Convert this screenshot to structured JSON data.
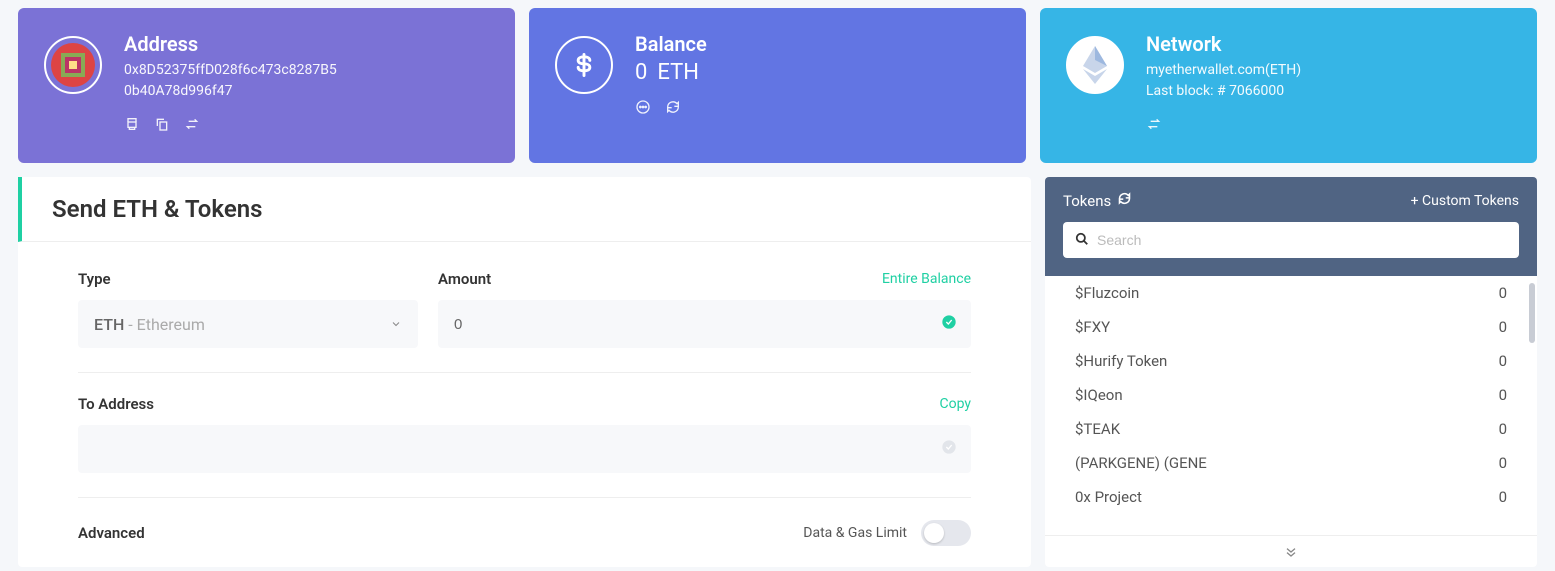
{
  "address_card": {
    "title": "Address",
    "line1": "0x8D52375ffD028f6c473c8287B5",
    "line2": "0b40A78d996f47"
  },
  "balance_card": {
    "title": "Balance",
    "amount": "0",
    "unit": "ETH"
  },
  "network_card": {
    "title": "Network",
    "name": "myetherwallet.com(ETH)",
    "last_block": "Last block: # 7066000"
  },
  "send": {
    "title": "Send ETH & Tokens",
    "type_label": "Type",
    "type_symbol": "ETH",
    "type_name": " - Ethereum",
    "amount_label": "Amount",
    "entire_balance": "Entire Balance",
    "amount_value": "0",
    "to_label": "To Address",
    "copy": "Copy",
    "to_value": "",
    "advanced_label": "Advanced",
    "gas_label": "Data & Gas Limit"
  },
  "tokens": {
    "title": "Tokens",
    "custom": "+ Custom Tokens",
    "search_placeholder": "Search",
    "list": [
      {
        "name": "$Fluzcoin",
        "balance": "0"
      },
      {
        "name": "$FXY",
        "balance": "0"
      },
      {
        "name": "$Hurify Token",
        "balance": "0"
      },
      {
        "name": "$IQeon",
        "balance": "0"
      },
      {
        "name": "$TEAK",
        "balance": "0"
      },
      {
        "name": "(PARKGENE) (GENE",
        "balance": "0"
      },
      {
        "name": "0x Project",
        "balance": "0"
      }
    ]
  }
}
